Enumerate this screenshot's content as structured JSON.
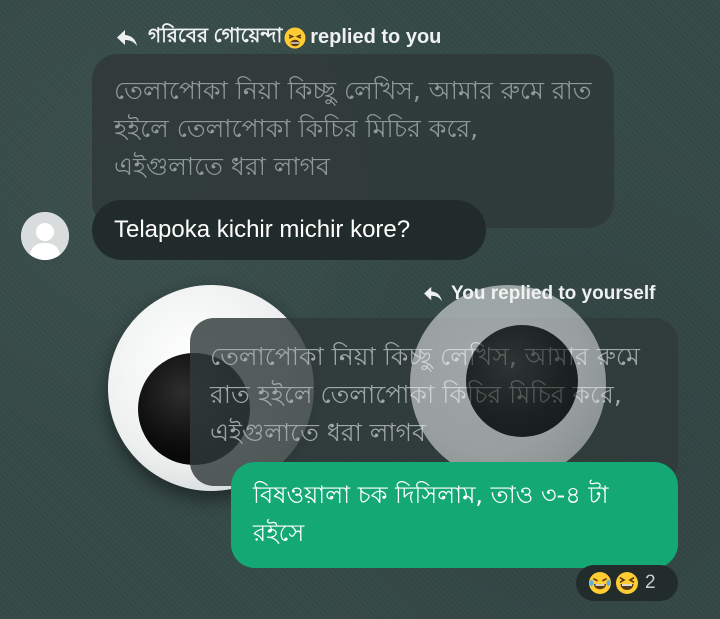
{
  "thread": {
    "reply_1": {
      "sender": "গরিবের গোয়েন্দা",
      "sender_emoji_icon": "tired-face-emoji",
      "suffix": "replied to you",
      "quoted_text": "তেলাপোকা নিয়া কিচ্ছু লেখিস, আমার রুমে রাত হইলে তেলাপোকা কিচির মিচির করে, এইগুলাতে ধরা লাগব",
      "message": "Telapoka kichir michir kore?"
    },
    "reply_2": {
      "header": "You replied to yourself",
      "quoted_text": "তেলাপোকা নিয়া কিচ্ছু লেখিস, আমার রুমে রাত হইলে তেলাপোকা কিচির মিচির করে, এইগুলাতে ধরা লাগব",
      "message": "বিষওয়ালা চক দিসিলাম, তাও ৩-৪ টা রইসে",
      "reactions": {
        "emoji_icons": [
          "laughing-tears-emoji",
          "grinning-squint-emoji"
        ],
        "count": "2"
      }
    }
  },
  "colors": {
    "background": "#354947",
    "quoted_bubble": "#2f3a39",
    "incoming_bubble": "#202b2a",
    "outgoing_bubble": "#14a874"
  }
}
